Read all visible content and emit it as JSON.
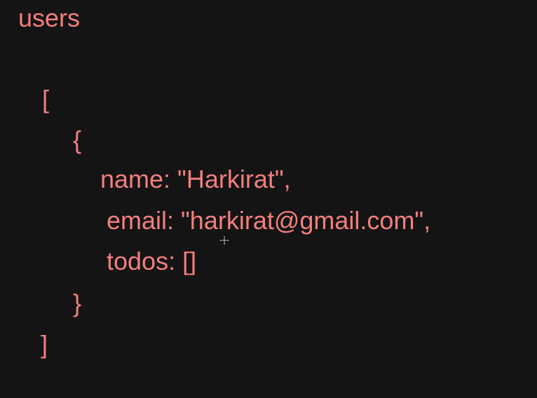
{
  "code": {
    "title": "users",
    "open_bracket": "[",
    "open_brace": "{",
    "name_line": "name: \"Harkirat\",",
    "email_line": "email: \"harkirat@gmail.com\",",
    "todos_line": "todos: []",
    "close_brace": "}",
    "close_bracket": "]"
  },
  "colors": {
    "background": "#141414",
    "text": "#f27f7d"
  },
  "icons": {
    "cursor": "move-cursor-icon"
  }
}
